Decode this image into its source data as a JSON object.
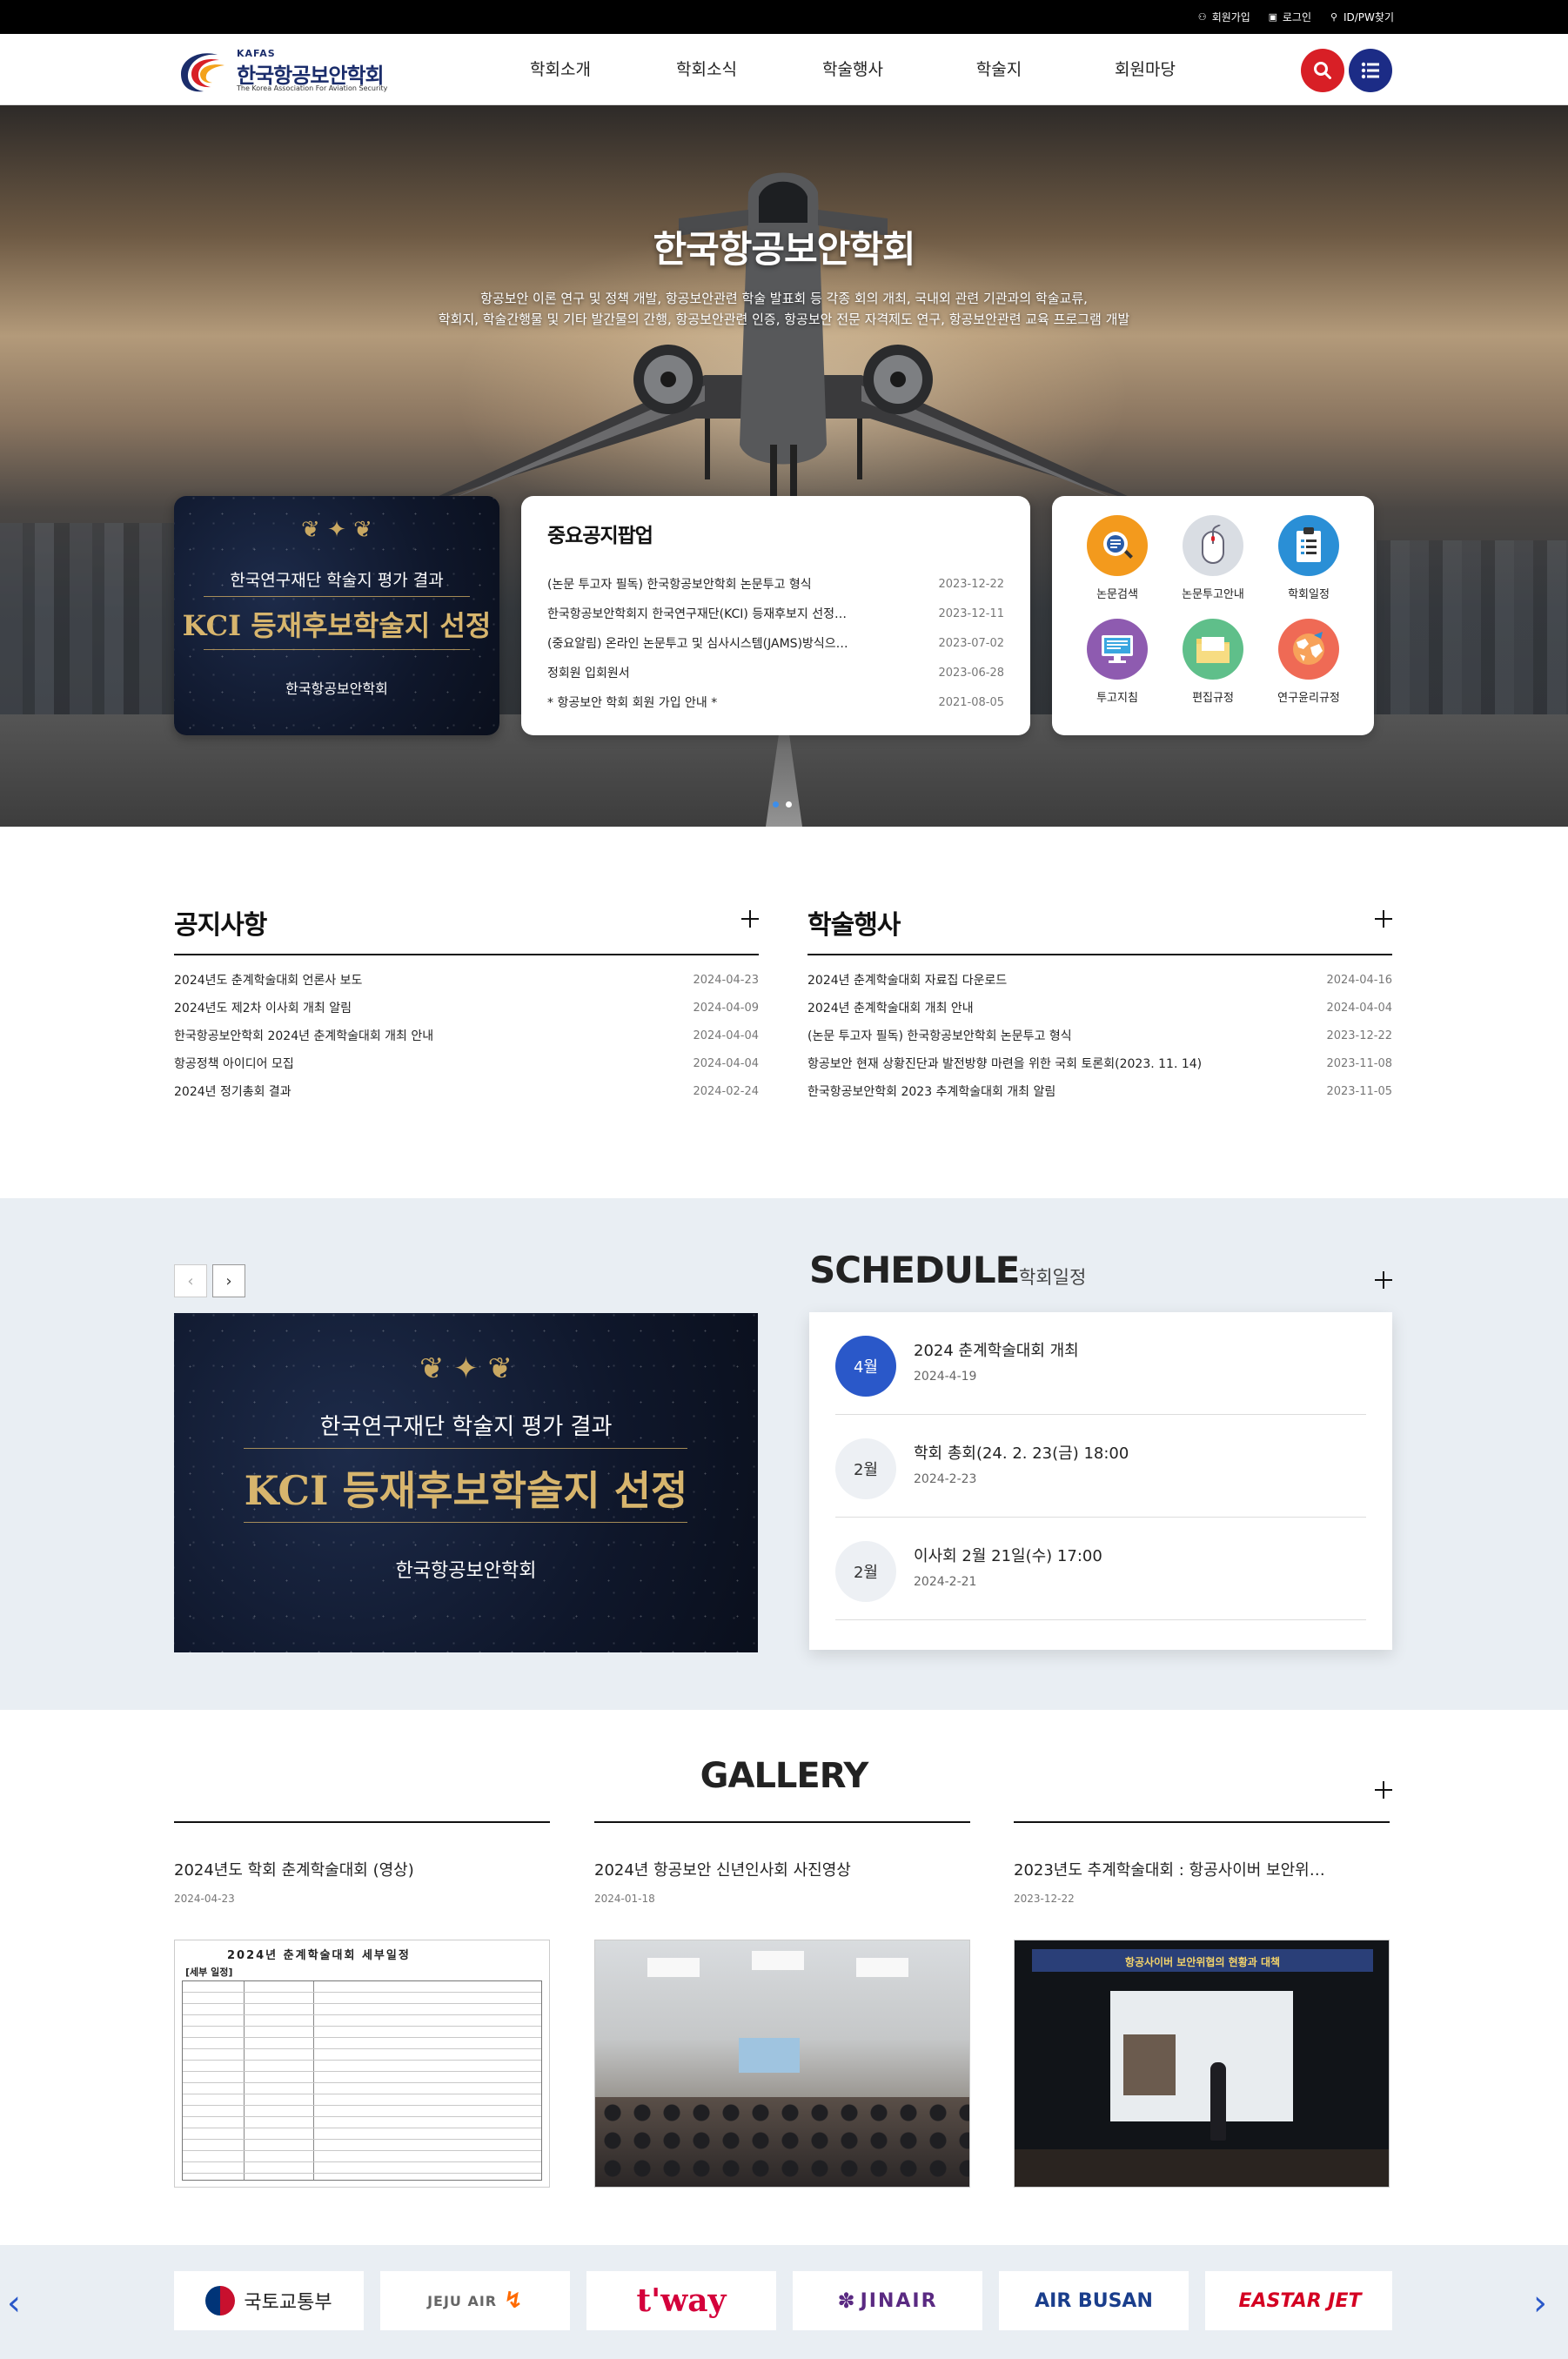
{
  "utility": {
    "join": "회원가입",
    "login": "로그인",
    "find": "ID/PW찾기"
  },
  "logo": {
    "abbr": "KAFAS",
    "name": "한국항공보안학회",
    "english": "The Korea Association For Aviation Security"
  },
  "nav": [
    "학회소개",
    "학회소식",
    "학술행사",
    "학술지",
    "회원마당"
  ],
  "hero": {
    "title": "한국항공보안학회",
    "desc_line1": "항공보안 이론 연구 및 정책 개발, 항공보안관련 학술 발표회 등 각종 회의 개최, 국내외 관련 기관과의 학술교류,",
    "desc_line2": "학회지, 학술간행물 및 기타 발간물의 간행, 항공보안관련 인증, 항공보안 전문 자격제도 연구, 항공보안관련 교육 프로그램 개발"
  },
  "kci_banner": {
    "line1": "한국연구재단 학술지 평가 결과",
    "line2": "KCI 등재후보학술지 선정",
    "line3": "한국항공보안학회"
  },
  "popup": {
    "title": "중요공지팝업",
    "items": [
      {
        "title": "(논문 투고자 필독) 한국항공보안학회 논문투고 형식",
        "date": "2023-12-22"
      },
      {
        "title": "한국항공보안학회지 한국연구재단(KCI) 등재후보지 선정…",
        "date": "2023-12-11"
      },
      {
        "title": "(중요알림) 온라인 논문투고 및 심사시스템(JAMS)방식으…",
        "date": "2023-07-02"
      },
      {
        "title": "정회원 입회원서",
        "date": "2023-06-28"
      },
      {
        "title": "* 항공보안 학회 회원 가입 안내 *",
        "date": "2021-08-05"
      }
    ]
  },
  "quick": [
    {
      "label": "논문검색",
      "icon": "search-document-icon",
      "color": "#f39a1d"
    },
    {
      "label": "논문투고안내",
      "icon": "mouse-icon",
      "color": "#d9dde3"
    },
    {
      "label": "학회일정",
      "icon": "clipboard-icon",
      "color": "#2a8fd6"
    },
    {
      "label": "투고지침",
      "icon": "monitor-icon",
      "color": "#8e5bb0"
    },
    {
      "label": "편집규정",
      "icon": "folder-icon",
      "color": "#5fbf8a"
    },
    {
      "label": "연구윤리규정",
      "icon": "world-map-icon",
      "color": "#ef6a55"
    }
  ],
  "notice": {
    "title": "공지사항",
    "items": [
      {
        "title": "2024년도 춘계학술대회 언론사 보도",
        "date": "2024-04-23"
      },
      {
        "title": "2024년도 제2차 이사회 개최 알림",
        "date": "2024-04-09"
      },
      {
        "title": "한국항공보안학회 2024년 춘계학술대회 개최 안내",
        "date": "2024-04-04"
      },
      {
        "title": "항공정책 아이디어 모집",
        "date": "2024-04-04"
      },
      {
        "title": "2024년 정기총회 결과",
        "date": "2024-02-24"
      }
    ]
  },
  "events": {
    "title": "학술행사",
    "items": [
      {
        "title": "2024년 춘계학술대회 자료집 다운로드",
        "date": "2024-04-16"
      },
      {
        "title": "2024년 춘계학술대회 개최 안내",
        "date": "2024-04-04"
      },
      {
        "title": "(논문 투고자 필독) 한국항공보안학회 논문투고 형식",
        "date": "2023-12-22"
      },
      {
        "title": "항공보안 현재 상황진단과 발전방향 마련을 위한 국회 토론회(2023. 11. 14)",
        "date": "2023-11-08"
      },
      {
        "title": "한국항공보안학회 2023 추계학술대회 개최 알림",
        "date": "2023-11-05"
      }
    ]
  },
  "schedule": {
    "title": "SCHEDULE",
    "subtitle": "학회일정",
    "items": [
      {
        "month": "4월",
        "title": "2024 춘계학술대회 개최",
        "date": "2024-4-19",
        "active": true
      },
      {
        "month": "2월",
        "title": "학회 총회(24. 2. 23(금) 18:00",
        "date": "2024-2-23",
        "active": false
      },
      {
        "month": "2월",
        "title": "이사회 2월 21일(수) 17:00",
        "date": "2024-2-21",
        "active": false
      }
    ]
  },
  "gallery": {
    "title": "GALLERY",
    "items": [
      {
        "title": "2024년도 학회 춘계학술대회 (영상)",
        "date": "2024-04-23"
      },
      {
        "title": "2024년 항공보안 신년인사회 사진영상",
        "date": "2024-01-18"
      },
      {
        "title": "2023년도 추계학술대회 : 항공사이버 보안위…",
        "date": "2023-12-22"
      }
    ],
    "doc_heading": "2024년 춘계학술대회 세부일정",
    "doc_tab": "[세부 일정]",
    "stage_banner": "항공사이버 보안위협의 현황과 대책"
  },
  "partners": [
    {
      "name": "국토교통부",
      "color": "#222222"
    },
    {
      "name": "JEJU AIR",
      "color": "#ff6a00"
    },
    {
      "name": "t'way",
      "color": "#d4003b"
    },
    {
      "name": "JINAIR",
      "color": "#5a2a82"
    },
    {
      "name": "AIR BUSAN",
      "color": "#1a3e8c"
    },
    {
      "name": "EASTAR JET",
      "color": "#d40022"
    }
  ],
  "colors": {
    "accent_red": "#d81f26",
    "accent_navy": "#1c2c86",
    "schedule_active": "#2a58c9"
  }
}
